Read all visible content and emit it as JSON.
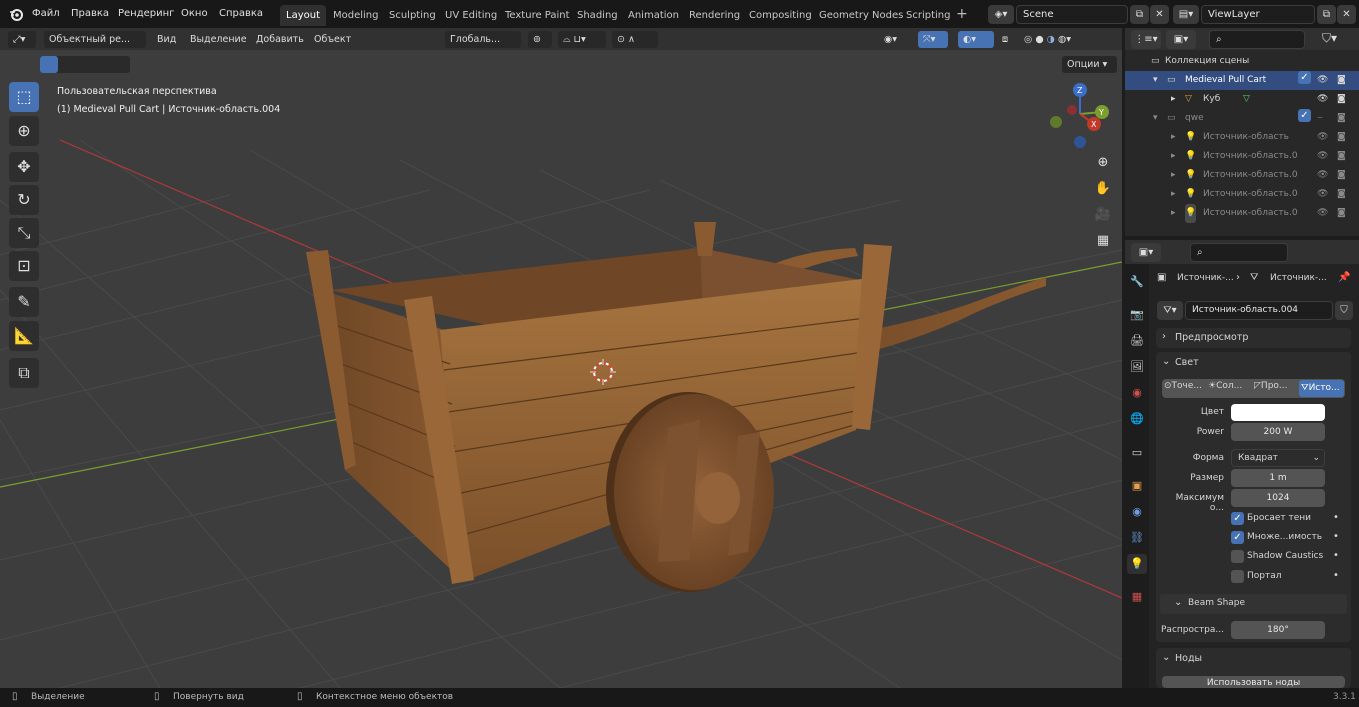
{
  "menu": {
    "items": [
      "Файл",
      "Правка",
      "Рендеринг",
      "Окно",
      "Справка"
    ]
  },
  "workspaces": {
    "tabs": [
      "Layout",
      "Modeling",
      "Sculpting",
      "UV Editing",
      "Texture Paint",
      "Shading",
      "Animation",
      "Rendering",
      "Compositing",
      "Geometry Nodes",
      "Scripting"
    ],
    "active": "Layout"
  },
  "scene": {
    "name": "Scene",
    "view_layer": "ViewLayer"
  },
  "viewport_header": {
    "mode": "Объектный ре...",
    "menus": [
      "Вид",
      "Выделение",
      "Добавить",
      "Объект"
    ],
    "transform_orientation": "Глобаль...",
    "options": "Опции"
  },
  "viewport": {
    "perspective_label": "Пользовательская перспектива",
    "object_label": "(1) Medieval Pull Cart | Источник-область.004"
  },
  "outliner": {
    "root": "Коллекция сцены",
    "rows": [
      {
        "label": "Medieval Pull Cart",
        "type": "collection",
        "selected": true
      },
      {
        "label": "Куб",
        "type": "mesh"
      },
      {
        "label": "qwe",
        "type": "collection"
      },
      {
        "label": "Источник-область",
        "type": "light"
      },
      {
        "label": "Источник-область.0",
        "type": "light"
      },
      {
        "label": "Источник-область.0",
        "type": "light"
      },
      {
        "label": "Источник-область.0",
        "type": "light"
      },
      {
        "label": "Источник-область.0",
        "type": "light"
      }
    ]
  },
  "properties": {
    "breadcrumb_1": "Источник-...",
    "breadcrumb_2": "Источник-...",
    "datablock": "Источник-область.004",
    "preview_label": "Предпросмотр",
    "light_label": "Свет",
    "light_types": [
      "Точе...",
      "Сол...",
      "Про...",
      "Исто..."
    ],
    "active_light_type": "Исто...",
    "color_label": "Цвет",
    "color_value": "#ffffff",
    "power_label": "Power",
    "power_value": "200 W",
    "shape_label": "Форма",
    "shape_value": "Квадрат",
    "size_label": "Размер",
    "size_value": "1 m",
    "max_label": "Максимум о...",
    "max_value": "1024",
    "cast_shadow": "Бросает тени",
    "multiple_importance": "Множе...имость",
    "shadow_caustics": "Shadow Caustics",
    "portal": "Портал",
    "beam_shape_label": "Beam Shape",
    "spread_label": "Распростра...",
    "spread_value": "180°",
    "nodes_label": "Ноды",
    "use_nodes": "Использовать ноды"
  },
  "status": {
    "select": "Выделение",
    "rotate": "Повернуть вид",
    "context": "Контекстное меню объектов",
    "version": "3.3.1"
  },
  "colors": {
    "accent": "#4772b3",
    "axis_x": "#c0392b",
    "axis_y": "#7a9f2e",
    "axis_z": "#3b6ec9"
  }
}
